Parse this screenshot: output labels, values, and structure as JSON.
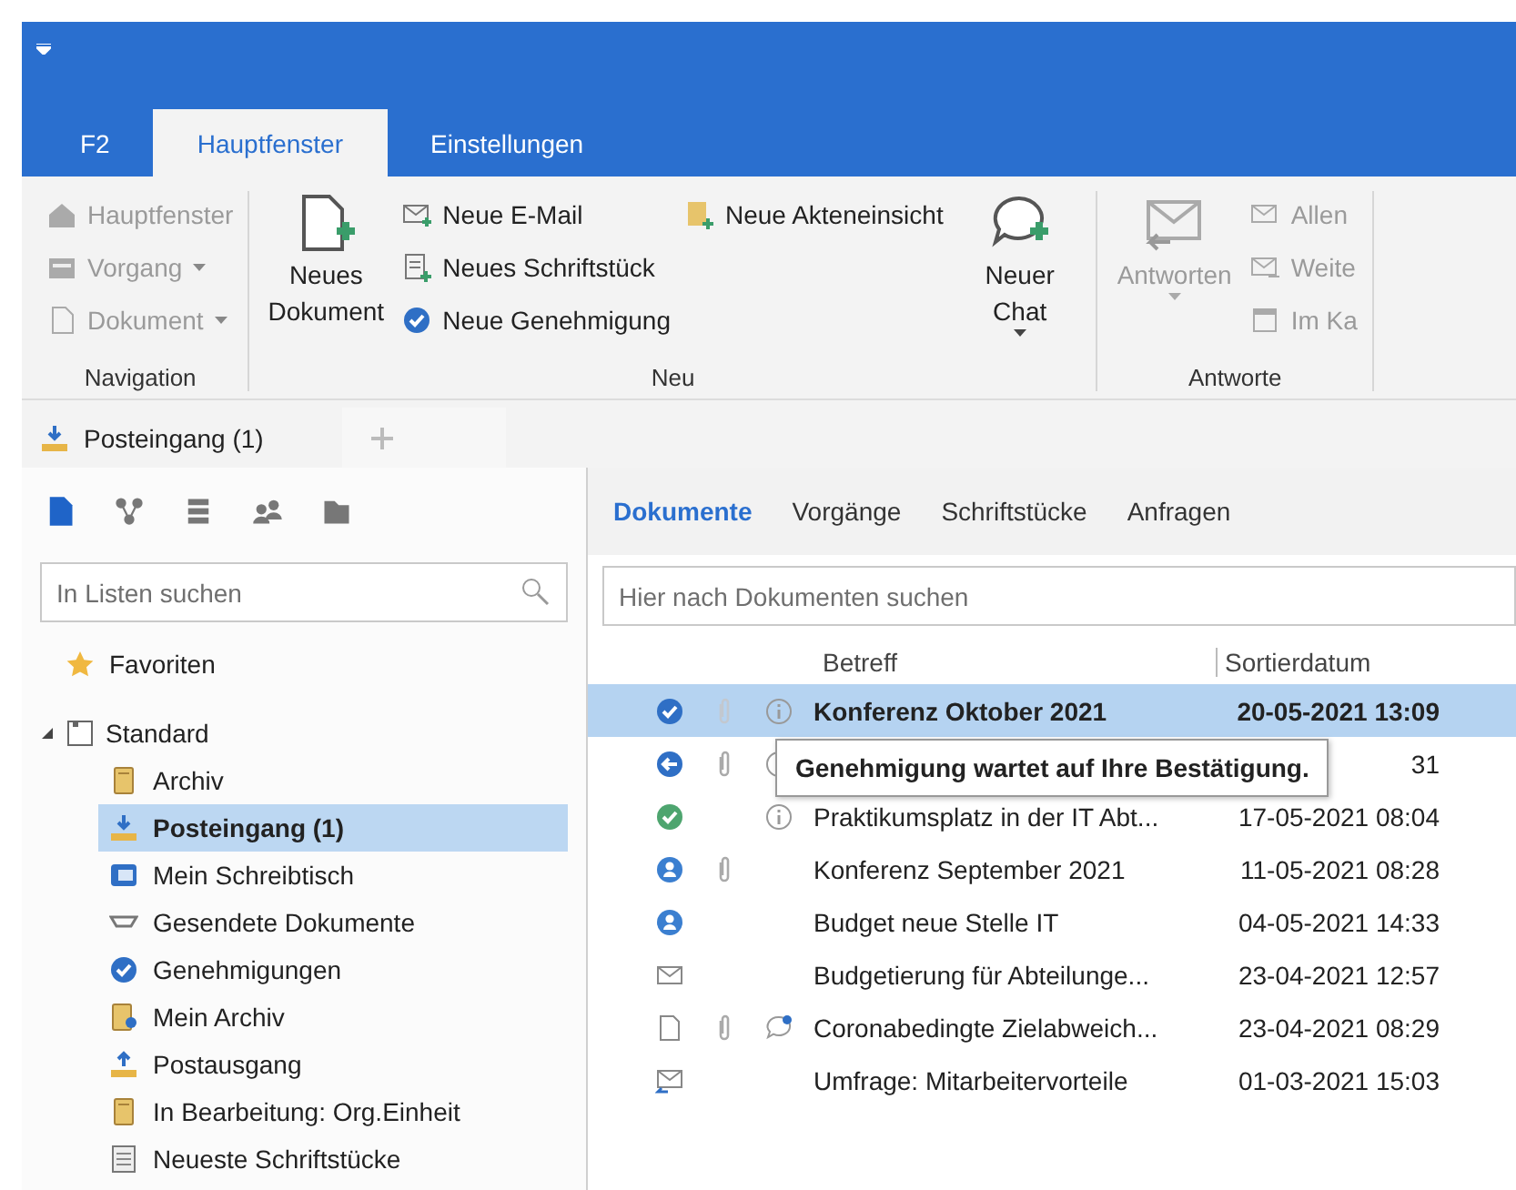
{
  "ribbon": {
    "tabs": [
      {
        "label": "F2",
        "selected": false
      },
      {
        "label": "Hauptfenster",
        "selected": true
      },
      {
        "label": "Einstellungen",
        "selected": false
      }
    ],
    "groups": [
      {
        "label": "Navigation",
        "items": [
          {
            "kind": "column",
            "items": [
              {
                "label": "Hauptfenster",
                "disabled": true,
                "dropdown": false
              },
              {
                "label": "Vorgang",
                "disabled": true,
                "dropdown": true
              },
              {
                "label": "Dokument",
                "disabled": true,
                "dropdown": true
              }
            ]
          }
        ]
      },
      {
        "label": "Neu",
        "items": [
          {
            "kind": "large",
            "label": "Neues Dokument",
            "disabled": false,
            "dropdown": false
          },
          {
            "kind": "column",
            "items": [
              {
                "label": "Neue E-Mail",
                "disabled": false,
                "dropdown": false
              },
              {
                "label": "Neues Schriftstück",
                "disabled": false,
                "dropdown": false
              },
              {
                "label": "Neue Genehmigung",
                "disabled": false,
                "dropdown": false
              }
            ]
          },
          {
            "kind": "column",
            "items": [
              {
                "label": "Neue Akteneinsicht",
                "disabled": false,
                "dropdown": false
              }
            ]
          },
          {
            "kind": "large",
            "label": "Neuer Chat",
            "disabled": false,
            "dropdown": true
          }
        ]
      },
      {
        "label": "Antworte",
        "items": [
          {
            "kind": "large",
            "label": "Antworten",
            "disabled": true,
            "dropdown": true
          },
          {
            "kind": "column",
            "items": [
              {
                "label": "Allen",
                "disabled": true,
                "dropdown": false
              },
              {
                "label": "Weite",
                "disabled": true,
                "dropdown": false
              },
              {
                "label": "Im Ka",
                "disabled": true,
                "dropdown": false
              }
            ]
          }
        ]
      }
    ]
  },
  "document_tabs": [
    {
      "label": "Posteingang (1)",
      "selected": true
    }
  ],
  "sidebar": {
    "toolbar": [
      {
        "selected": true
      },
      {
        "selected": false
      },
      {
        "selected": false
      },
      {
        "selected": false
      },
      {
        "selected": false
      }
    ],
    "search": {
      "placeholder": "In Listen suchen"
    },
    "tree": [
      {
        "label": "Favoriten",
        "selected": false
      },
      {
        "label": "Standard",
        "selected": false,
        "expanded": true,
        "children": [
          {
            "label": "Archiv",
            "selected": false
          },
          {
            "label": "Posteingang (1)",
            "selected": true
          },
          {
            "label": "Mein Schreibtisch",
            "selected": false
          },
          {
            "label": "Gesendete Dokumente",
            "selected": false
          },
          {
            "label": "Genehmigungen",
            "selected": false
          },
          {
            "label": "Mein Archiv",
            "selected": false
          },
          {
            "label": "Postausgang",
            "selected": false
          },
          {
            "label": "In Bearbeitung: Org.Einheit",
            "selected": false
          },
          {
            "label": "Neueste Schriftstücke",
            "selected": false
          }
        ]
      }
    ]
  },
  "content": {
    "tabs": [
      {
        "label": "Dokumente",
        "selected": true
      },
      {
        "label": "Vorgänge",
        "selected": false
      },
      {
        "label": "Schriftstücke",
        "selected": false
      },
      {
        "label": "Anfragen",
        "selected": false
      }
    ],
    "search": {
      "placeholder": "Hier nach Dokumenten suchen"
    },
    "table": {
      "columns": [
        "Betreff",
        "Sortierdatum"
      ],
      "rows": [
        {
          "kind": "pending",
          "attachment": true,
          "info": true,
          "chat": false,
          "subject": "Konferenz Oktober 2021",
          "date": "20-05-2021 13:09",
          "selected": true,
          "unread": true
        },
        {
          "kind": "returned",
          "attachment": true,
          "info": true,
          "chat": false,
          "date": "31",
          "selected": false,
          "unread": false
        },
        {
          "kind": "approved",
          "attachment": false,
          "info": true,
          "chat": false,
          "subject": "Praktikumsplatz in der IT Abt...",
          "date": "17-05-2021 08:04",
          "selected": false,
          "unread": false
        },
        {
          "kind": "person",
          "attachment": true,
          "info": false,
          "chat": false,
          "subject": "Konferenz September 2021",
          "date": "11-05-2021 08:28",
          "selected": false,
          "unread": false
        },
        {
          "kind": "person",
          "attachment": false,
          "info": false,
          "chat": false,
          "subject": "Budget neue Stelle IT",
          "date": "04-05-2021 14:33",
          "selected": false,
          "unread": false
        },
        {
          "kind": "mail",
          "attachment": false,
          "info": false,
          "chat": false,
          "subject": "Budgetierung für Abteilunge...",
          "date": "23-04-2021 12:57",
          "selected": false,
          "unread": false
        },
        {
          "kind": "document",
          "attachment": true,
          "info": false,
          "chat": true,
          "subject": "Coronabedingte Zielabweich...",
          "date": "23-04-2021 08:29",
          "selected": false,
          "unread": false
        },
        {
          "kind": "reply",
          "attachment": false,
          "info": false,
          "chat": false,
          "subject": "Umfrage: Mitarbeitervorteile",
          "date": "01-03-2021 15:03",
          "selected": false,
          "unread": false
        }
      ],
      "tooltip": {
        "text": "Genehmigung wartet auf Ihre Bestätigung."
      }
    }
  }
}
